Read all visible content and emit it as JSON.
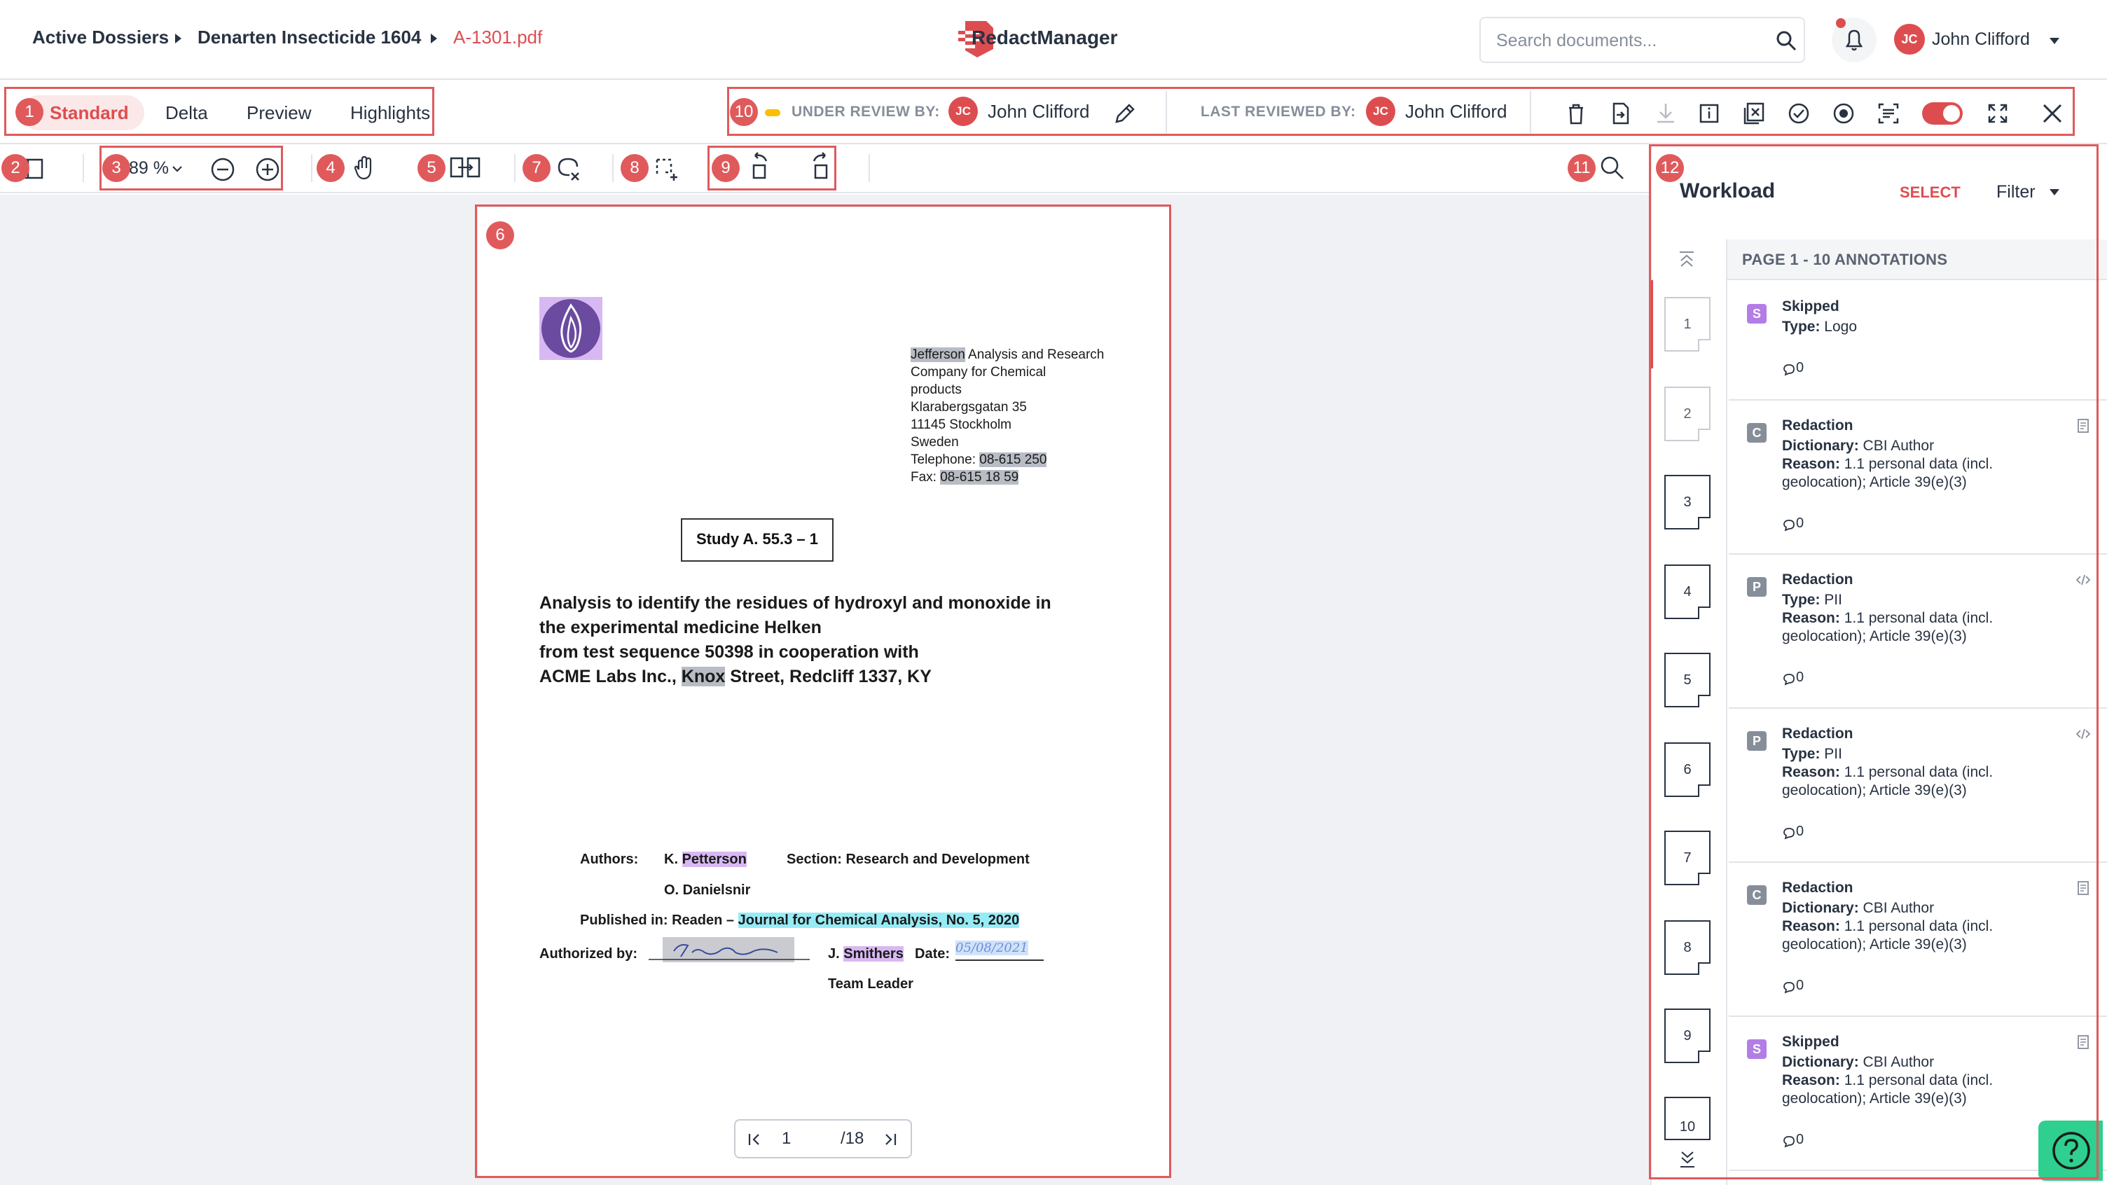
{
  "breadcrumb": {
    "items": [
      "Active Dossiers",
      "Denarten Insecticide 1604",
      "A-1301.pdf"
    ]
  },
  "app": {
    "name": "RedactManager"
  },
  "search": {
    "placeholder": "Search documents..."
  },
  "user": {
    "initials": "JC",
    "name": "John Clifford"
  },
  "view_tabs": [
    "Standard",
    "Delta",
    "Preview",
    "Highlights"
  ],
  "review": {
    "under_label": "UNDER REVIEW BY:",
    "under_initials": "JC",
    "under_name": "John Clifford",
    "last_label": "LAST REVIEWED BY:",
    "last_initials": "JC",
    "last_name": "John Clifford",
    "toggle_on": true
  },
  "viewer": {
    "zoom": "89 %",
    "current_page": "1",
    "total_pages": "/18"
  },
  "document": {
    "company": [
      "Jefferson",
      " Analysis and Research"
    ],
    "address_lines": [
      "Company for Chemical",
      "products",
      "Klarabergsgatan 35",
      "11145 Stockholm",
      "Sweden"
    ],
    "telephone_label": "Telephone: ",
    "telephone": "08-615 250",
    "fax_label": "Fax: ",
    "fax": "08-615 18 59",
    "study": "Study A. 55.3 – 1",
    "title_lines": [
      "Analysis to identify the residues of hydroxyl and monoxide in",
      "the experimental medicine Helken",
      "from test sequence 50398 in cooperation with"
    ],
    "title_last_pre": "ACME Labs Inc., ",
    "title_last_hl": "Knox",
    "title_last_post": " Street, Redcliff 1337, KY",
    "authors_label": "Authors:",
    "author1_pre": "K. ",
    "author1_hl": "Petterson",
    "section": "Section: Research and Development",
    "author2": "O. Danielsnir",
    "published_label": "Published in: Readen – ",
    "published_hl": "Journal for Chemical Analysis, No. 5, 2020",
    "authorized_label": "Authorized by:",
    "signer_pre": "J. ",
    "signer_hl": "Smithers",
    "date_label": "Date:",
    "date_value": "05/08/2021",
    "team": "Team Leader"
  },
  "panel": {
    "title": "Workload",
    "select": "SELECT",
    "filter": "Filter",
    "page_label": "PAGE 1 - 10 ANNOTATIONS",
    "thumbnails": [
      "1",
      "2",
      "3",
      "4",
      "5",
      "6",
      "7",
      "8",
      "9",
      "10"
    ],
    "annotations": [
      {
        "badge": "S",
        "badge_color": "#b37de6",
        "head": "Skipped",
        "l1k": "Type:",
        "l1v": " Logo",
        "l2k": "",
        "l2v": "",
        "l3": "",
        "count": "0",
        "icon": ""
      },
      {
        "badge": "C",
        "badge_color": "#868e9a",
        "head": "Redaction",
        "l1k": "Dictionary:",
        "l1v": " CBI Author",
        "l2k": "Reason:",
        "l2v": " 1.1 personal data (incl.",
        "l3": "geolocation); Article 39(e)(3)",
        "count": "0",
        "icon": "doc"
      },
      {
        "badge": "P",
        "badge_color": "#868e9a",
        "head": "Redaction",
        "l1k": "Type:",
        "l1v": " PII",
        "l2k": "Reason:",
        "l2v": " 1.1 personal data (incl.",
        "l3": "geolocation); Article 39(e)(3)",
        "count": "0",
        "icon": "code"
      },
      {
        "badge": "P",
        "badge_color": "#868e9a",
        "head": "Redaction",
        "l1k": "Type:",
        "l1v": " PII",
        "l2k": "Reason:",
        "l2v": " 1.1 personal data (incl.",
        "l3": "geolocation); Article 39(e)(3)",
        "count": "0",
        "icon": "code"
      },
      {
        "badge": "C",
        "badge_color": "#868e9a",
        "head": "Redaction",
        "l1k": "Dictionary:",
        "l1v": " CBI Author",
        "l2k": "Reason:",
        "l2v": " 1.1 personal data (incl.",
        "l3": "geolocation); Article 39(e)(3)",
        "count": "0",
        "icon": "doc"
      },
      {
        "badge": "S",
        "badge_color": "#b37de6",
        "head": "Skipped",
        "l1k": "Dictionary:",
        "l1v": " CBI Author",
        "l2k": "Reason:",
        "l2v": " 1.1 personal data (incl.",
        "l3": "geolocation); Article 39(e)(3)",
        "count": "0",
        "icon": "doc"
      }
    ]
  },
  "callouts": [
    "1",
    "2",
    "3",
    "4",
    "5",
    "6",
    "7",
    "8",
    "9",
    "10",
    "11",
    "12"
  ],
  "colors": {
    "accent": "#dd4d50",
    "callout": "#e05a5c",
    "help": "#2fcf8f"
  }
}
